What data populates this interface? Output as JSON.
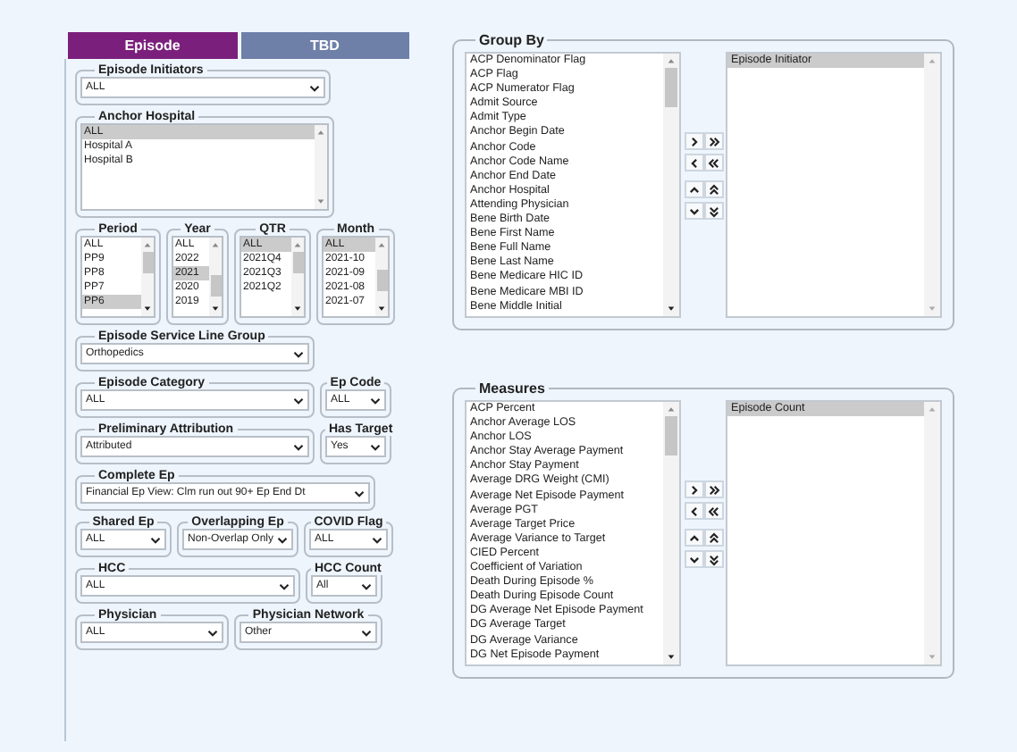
{
  "tabs": [
    {
      "label": "Episode",
      "selected": true
    },
    {
      "label": "TBD",
      "selected": false
    }
  ],
  "filter_rows": [
    [
      {
        "legend": "Episode Initiators",
        "kind": "select",
        "value": "ALL"
      }
    ],
    [
      {
        "legend": "Anchor Hospital",
        "kind": "listbox",
        "items": [
          {
            "label": "ALL",
            "selected": true
          },
          {
            "label": "Hospital A",
            "selected": false
          },
          {
            "label": "Hospital B",
            "selected": false
          }
        ]
      }
    ],
    [
      {
        "legend": "Period",
        "kind": "listbox",
        "items": [
          {
            "label": "ALL",
            "selected": false
          },
          {
            "label": "PP9",
            "selected": false
          },
          {
            "label": "PP8",
            "selected": false
          },
          {
            "label": "PP7",
            "selected": false
          },
          {
            "label": "PP6",
            "selected": true
          }
        ]
      },
      {
        "legend": "Year",
        "kind": "listbox",
        "items": [
          {
            "label": "ALL",
            "selected": false
          },
          {
            "label": "2022",
            "selected": false
          },
          {
            "label": "2021",
            "selected": true
          },
          {
            "label": "2020",
            "selected": false
          },
          {
            "label": "2019",
            "selected": false
          }
        ]
      },
      {
        "legend": "QTR",
        "kind": "listbox",
        "items": [
          {
            "label": "ALL",
            "selected": true
          },
          {
            "label": "2021Q4",
            "selected": false
          },
          {
            "label": "2021Q3",
            "selected": false
          },
          {
            "label": "2021Q2",
            "selected": false
          }
        ]
      },
      {
        "legend": "Month",
        "kind": "listbox",
        "items": [
          {
            "label": "ALL",
            "selected": true
          },
          {
            "label": "2021-10",
            "selected": false
          },
          {
            "label": "2021-09",
            "selected": false
          },
          {
            "label": "2021-08",
            "selected": false
          },
          {
            "label": "2021-07",
            "selected": false
          }
        ]
      }
    ],
    [
      {
        "legend": "Episode Service Line Group",
        "kind": "select",
        "value": "Orthopedics"
      }
    ],
    [
      {
        "legend": "Episode Category",
        "kind": "select",
        "value": "ALL"
      },
      {
        "legend": "Ep Code",
        "kind": "select",
        "value": "ALL"
      }
    ],
    [
      {
        "legend": "Preliminary Attribution",
        "kind": "select",
        "value": "Attributed"
      },
      {
        "legend": "Has Target",
        "kind": "select",
        "value": "Yes"
      }
    ],
    [
      {
        "legend": "Complete Ep",
        "kind": "select",
        "value": "Financial Ep View: Clm run out 90+ Ep End Dt"
      }
    ],
    [
      {
        "legend": "Shared Ep",
        "kind": "select",
        "value": "ALL"
      },
      {
        "legend": "Overlapping Ep",
        "kind": "select",
        "value": "Non-Overlap Only"
      },
      {
        "legend": "COVID Flag",
        "kind": "select",
        "value": "ALL"
      }
    ],
    [
      {
        "legend": "HCC",
        "kind": "select",
        "value": "ALL"
      },
      {
        "legend": "HCC Count",
        "kind": "select",
        "value": "All"
      }
    ],
    [
      {
        "legend": "Physician",
        "kind": "select",
        "value": "ALL"
      },
      {
        "legend": "Physician Network",
        "kind": "select",
        "value": "Other"
      }
    ]
  ],
  "group_by": {
    "legend": "Group By",
    "available": [
      "ACP Denominator Flag",
      "ACP Flag",
      "ACP Numerator Flag",
      "Admit Source",
      "Admit Type",
      "Anchor Begin Date",
      "Anchor Code",
      "Anchor Code Name",
      "Anchor End Date",
      "Anchor Hospital",
      "Attending Physician",
      "Bene Birth Date",
      "Bene First Name",
      "Bene Full Name",
      "Bene Last Name",
      "Bene Medicare HIC ID",
      "Bene Medicare MBI ID",
      "Bene Middle Initial"
    ],
    "chosen": [
      {
        "label": "Episode Initiator",
        "selected": true
      }
    ]
  },
  "measures": {
    "legend": "Measures",
    "available": [
      "ACP Percent",
      "Anchor Average LOS",
      "Anchor LOS",
      "Anchor Stay Average Payment",
      "Anchor Stay Payment",
      "Average DRG Weight (CMI)",
      "Average Net Episode Payment",
      "Average PGT",
      "Average Target Price",
      "Average Variance to Target",
      "CIED Percent",
      "Coefficient of Variation",
      "Death During Episode %",
      "Death During Episode Count",
      "DG Average Net Episode Payment",
      "DG Average Target",
      "DG Average Variance",
      "DG Net Episode Payment"
    ],
    "chosen": [
      {
        "label": "Episode Count",
        "selected": true
      }
    ]
  }
}
